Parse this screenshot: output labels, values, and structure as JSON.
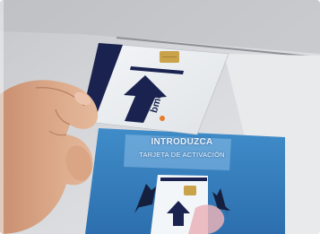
{
  "panel": {
    "instruction_title": "INTRODUZCA",
    "instruction_subtitle": "TARJETA DE ACTIVACIÓN"
  },
  "card": {
    "brand": "bmo"
  },
  "colors": {
    "wall": "#cfd1d5",
    "panel_blue": "#3c86c4",
    "card_navy": "#1a2350",
    "chip_gold": "#c9a24a",
    "skin": "#d6a283"
  },
  "icons": [
    "up-arrow-icon",
    "diagonal-arrow-icon",
    "card-chip-icon"
  ]
}
